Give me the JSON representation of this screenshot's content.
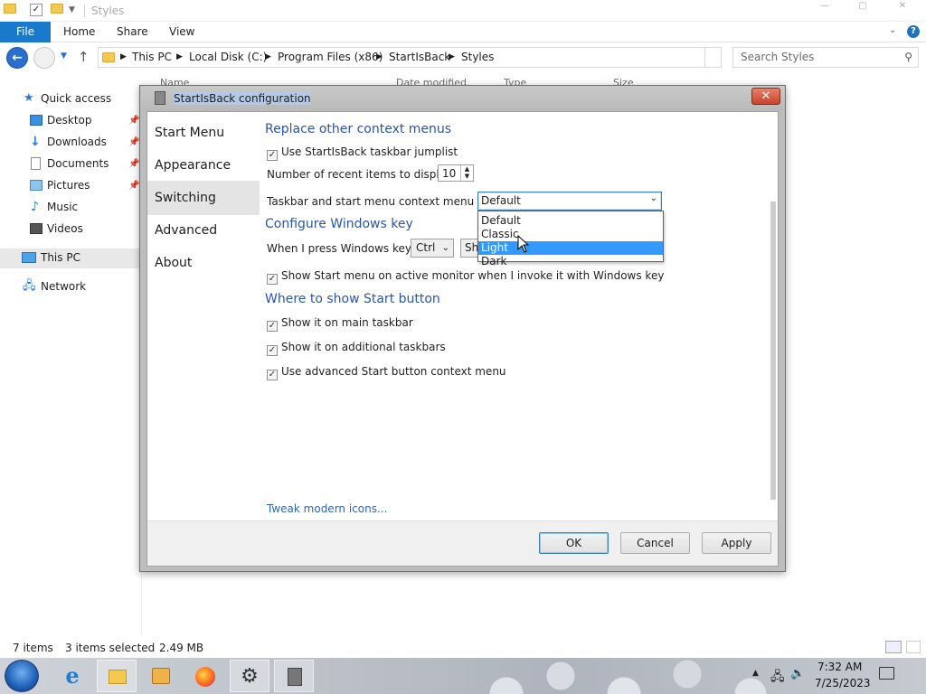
{
  "explorer": {
    "window_title": "Styles",
    "ribbon_tabs": [
      "File",
      "Home",
      "Share",
      "View"
    ],
    "breadcrumbs": [
      "This PC",
      "Local Disk (C:)",
      "Program Files (x86)",
      "StartIsBack",
      "Styles"
    ],
    "search_placeholder": "Search Styles",
    "nav_items": [
      {
        "label": "Quick access",
        "icon": "star-icon"
      },
      {
        "label": "Desktop",
        "icon": "desktop-icon"
      },
      {
        "label": "Downloads",
        "icon": "downloads-icon"
      },
      {
        "label": "Documents",
        "icon": "documents-icon"
      },
      {
        "label": "Pictures",
        "icon": "pictures-icon"
      },
      {
        "label": "Music",
        "icon": "music-icon"
      },
      {
        "label": "Videos",
        "icon": "videos-icon"
      },
      {
        "label": "This PC",
        "icon": "computer-icon"
      },
      {
        "label": "Network",
        "icon": "network-icon"
      }
    ],
    "column_headers": [
      "Name",
      "Date modified",
      "Type",
      "Size"
    ],
    "status": {
      "items": "7 items",
      "selected": "3 items selected",
      "size": "2.49 MB"
    }
  },
  "dialog": {
    "title": "StartIsBack configuration",
    "categories": [
      "Start Menu",
      "Appearance",
      "Switching",
      "Advanced",
      "About"
    ],
    "selected_category": "Switching",
    "sections": {
      "context_menus": "Replace other context menus",
      "windows_key": "Configure Windows key",
      "start_button": "Where to show Start button"
    },
    "options": {
      "use_jumplist": "Use StartIsBack taskbar jumplist",
      "recent_items_label": "Number of recent items to display:",
      "recent_items_value": "10",
      "context_style_label": "Taskbar and start menu context menu style",
      "context_style_value": "Default",
      "context_style_options": [
        "Default",
        "Classic",
        "Light",
        "Dark"
      ],
      "context_style_highlighted": "Light",
      "win_key_label": "When I press Windows key +",
      "win_key_modifier": "Ctrl",
      "win_key_action": "Sh",
      "show_on_active_monitor": "Show Start menu on active monitor when I invoke it with Windows key",
      "show_main_taskbar": "Show it on main taskbar",
      "show_additional_taskbars": "Show it on additional taskbars",
      "advanced_context_menu": "Use advanced Start button context menu"
    },
    "link_tweak": "Tweak modern icons...",
    "buttons": {
      "ok": "OK",
      "cancel": "Cancel",
      "apply": "Apply"
    }
  },
  "taskbar": {
    "apps": [
      "start-icon",
      "internet-explorer-icon",
      "file-explorer-icon",
      "media-player-icon",
      "firefox-icon",
      "settings-gear-icon",
      "startisback-icon"
    ],
    "clock_time": "7:32 AM",
    "clock_date": "7/25/2023"
  },
  "colors": {
    "accent": "#1979ca",
    "dropdown_highlight": "#3399ff",
    "section_heading": "#2a56a8"
  }
}
